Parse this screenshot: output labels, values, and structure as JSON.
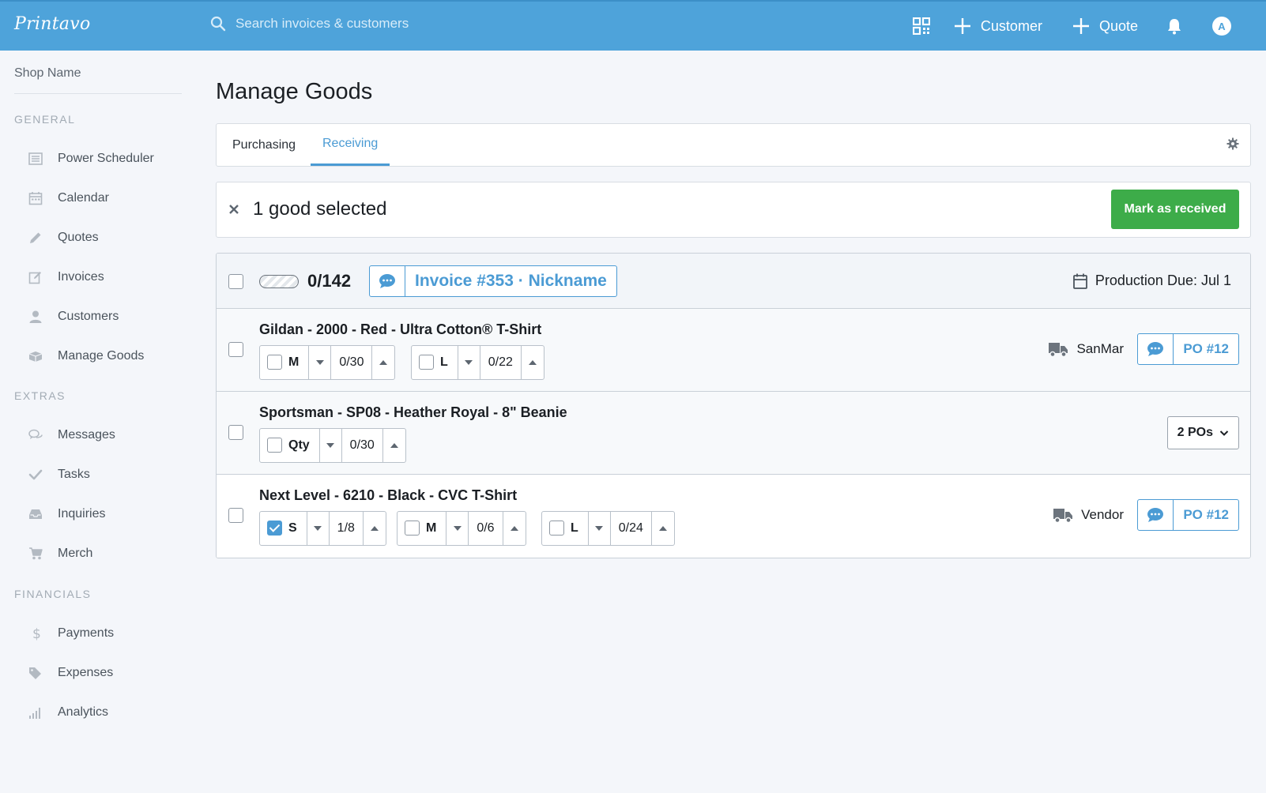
{
  "app": {
    "logo": "Printavo",
    "search_placeholder": "Search invoices & customers",
    "actions": {
      "customer": "Customer",
      "quote": "Quote"
    },
    "avatar_initial": "A",
    "accent_color": "#4ea3da",
    "success_color": "#3dac49"
  },
  "sidebar": {
    "shop_name": "Shop Name",
    "sections": {
      "general": "GENERAL",
      "extras": "EXTRAS",
      "financials": "FINANCIALS"
    },
    "items": {
      "power_scheduler": "Power Scheduler",
      "calendar": "Calendar",
      "quotes": "Quotes",
      "invoices": "Invoices",
      "customers": "Customers",
      "manage_goods": "Manage Goods",
      "messages": "Messages",
      "tasks": "Tasks",
      "inquiries": "Inquiries",
      "merch": "Merch",
      "payments": "Payments",
      "expenses": "Expenses",
      "analytics": "Analytics"
    }
  },
  "main": {
    "title": "Manage Goods",
    "tabs": {
      "purchasing": "Purchasing",
      "receiving": "Receiving",
      "active": "receiving"
    },
    "selection": {
      "text": "1 good selected",
      "button": "Mark as received"
    },
    "invoice": {
      "count": "0/142",
      "label": "Invoice #353 · Nickname",
      "due": "Production Due: Jul 1",
      "checked": false
    },
    "items": [
      {
        "title": "Gildan - 2000 - Red - Ultra Cotton® T-Shirt",
        "sizes": [
          {
            "label": "M",
            "qty": "0/30",
            "checked": false
          },
          {
            "label": "L",
            "qty": "0/22",
            "checked": false
          }
        ],
        "vendor": "SanMar",
        "po": "PO #12"
      },
      {
        "title": "Sportsman - SP08 - Heather Royal - 8\" Beanie",
        "sizes": [
          {
            "label": "Qty",
            "qty": "0/30",
            "checked": false
          }
        ],
        "po_dropdown": "2 POs"
      },
      {
        "title": "Next Level - 6210 - Black - CVC T-Shirt",
        "sizes": [
          {
            "label": "S",
            "qty": "1/8",
            "checked": true
          },
          {
            "label": "M",
            "qty": "0/6",
            "checked": false
          },
          {
            "label": "L",
            "qty": "0/24",
            "checked": false
          }
        ],
        "vendor": "Vendor",
        "po": "PO #12"
      }
    ]
  }
}
